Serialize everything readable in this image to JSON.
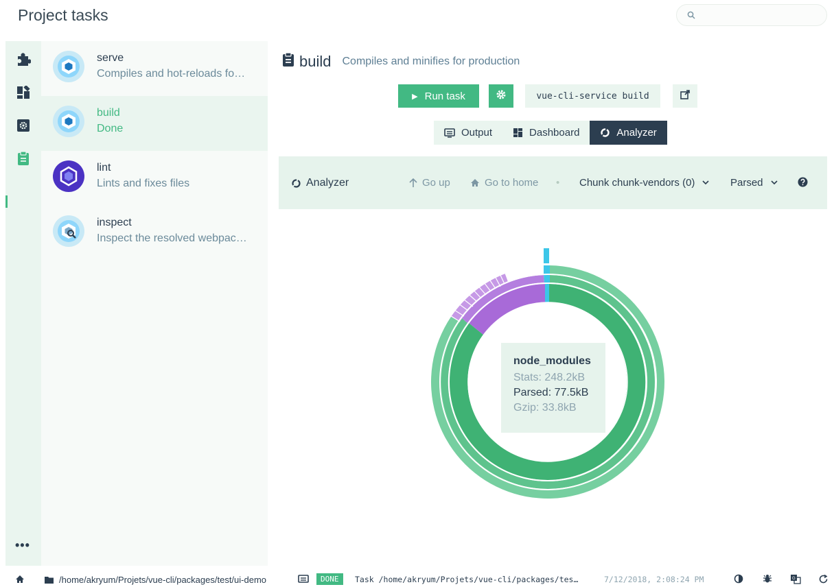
{
  "header": {
    "title": "Project tasks",
    "search_placeholder": ""
  },
  "nav": {
    "items": [
      {
        "icon": "puzzle-icon"
      },
      {
        "icon": "dashboard-icon"
      },
      {
        "icon": "settings-icon"
      },
      {
        "icon": "clipboard-icon"
      }
    ],
    "more_label": "•••"
  },
  "tasks": [
    {
      "name": "serve",
      "description": "Compiles and hot-reloads fo…"
    },
    {
      "name": "build",
      "description": "Done"
    },
    {
      "name": "lint",
      "description": "Lints and fixes files"
    },
    {
      "name": "inspect",
      "description": "Inspect the resolved webpac…"
    }
  ],
  "main": {
    "task_name": "build",
    "task_description": "Compiles and minifies for production",
    "run_label": "Run task",
    "command": "vue-cli-service build",
    "tabs": [
      {
        "label": "Output"
      },
      {
        "label": "Dashboard"
      },
      {
        "label": "Analyzer"
      }
    ]
  },
  "analyzer": {
    "title": "Analyzer",
    "go_up": "Go up",
    "go_home": "Go to home",
    "separator": "•",
    "chunk_select": "Chunk chunk-vendors (0)",
    "size_select": "Parsed",
    "tooltip": {
      "name": "node_modules",
      "stats": "Stats: 248.2kB",
      "parsed": "Parsed: 77.5kB",
      "gzip": "Gzip: 33.8kB"
    }
  },
  "statusbar": {
    "path": "/home/akryum/Projets/vue-cli/packages/test/ui-demo",
    "badge": "DONE",
    "message": "Task /home/akryum/Projets/vue-cli/packages/tes…",
    "time": "7/12/2018, 2:08:24 PM"
  },
  "colors": {
    "accent": "#42b983",
    "dark": "#2c3e50",
    "purple": "#9a5fd6",
    "cyan": "#3cc6e8"
  }
}
